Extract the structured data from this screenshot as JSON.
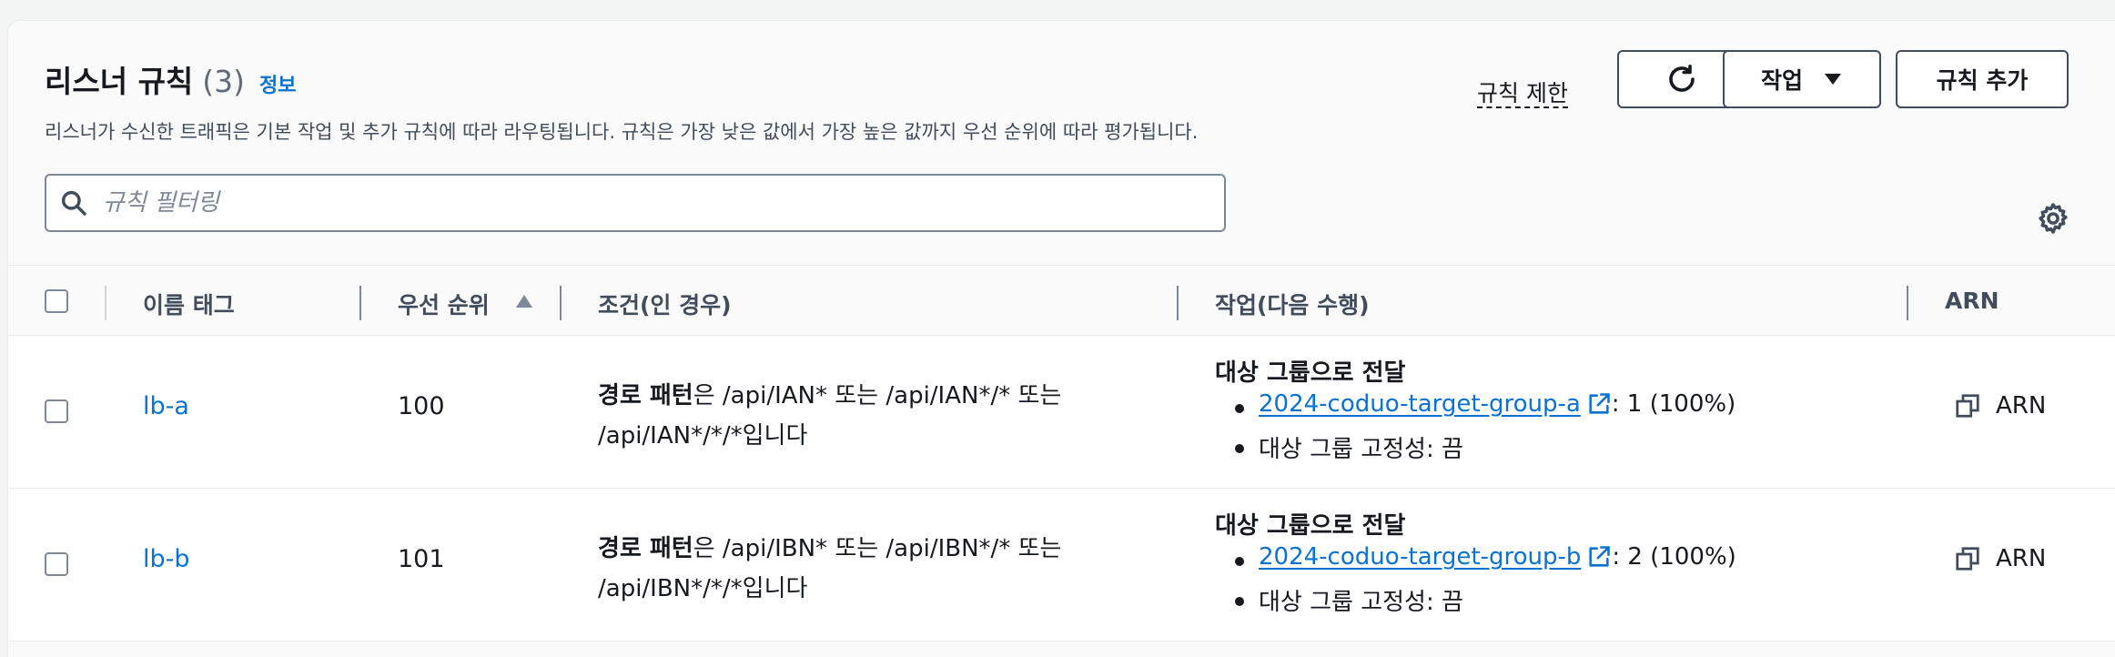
{
  "header": {
    "title": "리스너 규칙",
    "count": "(3)",
    "info_link": "정보",
    "description": "리스너가 수신한 트래픽은 기본 작업 및 추가 규칙에 따라 라우팅됩니다. 규칙은 가장 낮은 값에서 가장 높은 값까지 우선 순위에 따라 평가됩니다.",
    "rule_limits_link": "규칙 제한",
    "actions_button": "작업",
    "add_rule_button": "규칙 추가"
  },
  "search": {
    "placeholder": "규칙 필터링",
    "value": ""
  },
  "table": {
    "columns": {
      "name_tag": "이름 태그",
      "priority": "우선 순위",
      "conditions": "조건(인 경우)",
      "actions": "작업(다음 수행)",
      "arn": "ARN"
    },
    "rows": [
      {
        "name": "lb-a",
        "priority": "100",
        "cond_bold": "경로 패턴",
        "cond_line1": "은 /api/IAN* 또는 /api/IAN*/* 또는",
        "cond_line2": "/api/IAN*/*/*입니다",
        "action_title": "대상 그룹으로 전달",
        "target_group": "2024-coduo-target-group-a",
        "weight": ": 1 (100%)",
        "stickiness": "대상 그룹 고정성: 끔",
        "arn": "ARN"
      },
      {
        "name": "lb-b",
        "priority": "101",
        "cond_bold": "경로 패턴",
        "cond_line1": "은 /api/IBN* 또는 /api/IBN*/* 또는",
        "cond_line2": "/api/IBN*/*/*입니다",
        "action_title": "대상 그룹으로 전달",
        "target_group": "2024-coduo-target-group-b",
        "weight": ": 2 (100%)",
        "stickiness": "대상 그룹 고정성: 끔",
        "arn": "ARN"
      }
    ]
  },
  "colors": {
    "link": "#0972d3",
    "text": "#16191f",
    "border": "#414d5c"
  },
  "icons": [
    "refresh-icon",
    "caret-down-icon",
    "search-icon",
    "settings-gear-icon",
    "external-link-icon",
    "copy-icon",
    "sort-ascending-icon"
  ]
}
